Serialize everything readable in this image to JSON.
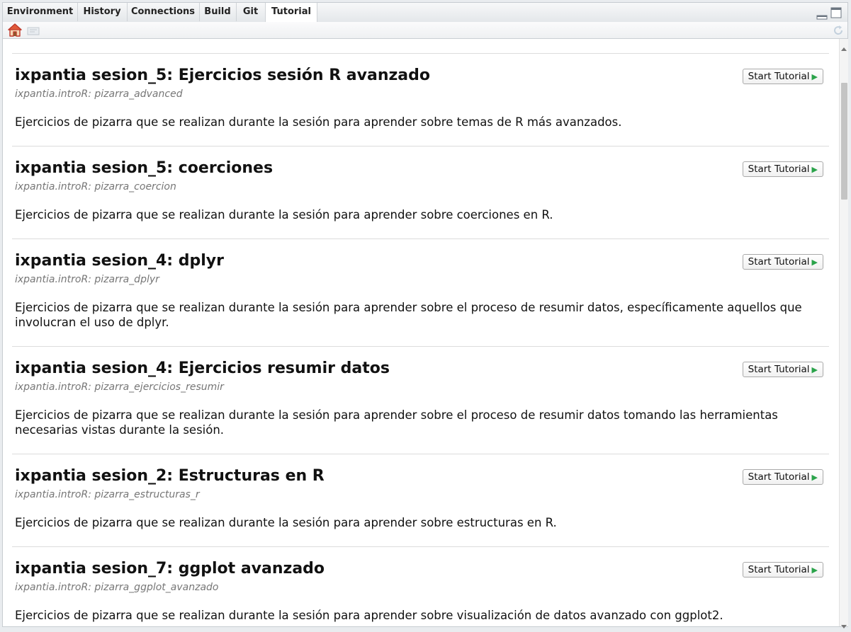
{
  "tabs": [
    {
      "label": "Environment",
      "active": false
    },
    {
      "label": "History",
      "active": false
    },
    {
      "label": "Connections",
      "active": false
    },
    {
      "label": "Build",
      "active": false
    },
    {
      "label": "Git",
      "active": false
    },
    {
      "label": "Tutorial",
      "active": true
    }
  ],
  "toolbar": {
    "home_icon": "home-icon",
    "stop_icon": "stop-icon",
    "refresh_icon": "refresh-icon"
  },
  "tutorials": [
    {
      "title": "ixpantia sesion_5: Ejercicios sesión R avanzado",
      "package": "ixpantia.introR: pizarra_advanced",
      "description": "Ejercicios de pizarra que se realizan durante la sesión para aprender sobre temas de R más avanzados.",
      "button": "Start Tutorial"
    },
    {
      "title": "ixpantia sesion_5: coerciones",
      "package": "ixpantia.introR: pizarra_coercion",
      "description": "Ejercicios de pizarra que se realizan durante la sesión para aprender sobre coerciones en R.",
      "button": "Start Tutorial"
    },
    {
      "title": "ixpantia sesion_4: dplyr",
      "package": "ixpantia.introR: pizarra_dplyr",
      "description": "Ejercicios de pizarra que se realizan durante la sesión para aprender sobre el proceso de resumir datos, específicamente aquellos que involucran el uso de dplyr.",
      "button": "Start Tutorial"
    },
    {
      "title": "ixpantia sesion_4: Ejercicios resumir datos",
      "package": "ixpantia.introR: pizarra_ejercicios_resumir",
      "description": "Ejercicios de pizarra que se realizan durante la sesión para aprender sobre el proceso de resumir datos tomando las herramientas necesarias vistas durante la sesión.",
      "button": "Start Tutorial"
    },
    {
      "title": "ixpantia sesion_2: Estructuras en R",
      "package": "ixpantia.introR: pizarra_estructuras_r",
      "description": "Ejercicios de pizarra que se realizan durante la sesión para aprender sobre estructuras en R.",
      "button": "Start Tutorial"
    },
    {
      "title": "ixpantia sesion_7: ggplot avanzado",
      "package": "ixpantia.introR: pizarra_ggplot_avanzado",
      "description": "Ejercicios de pizarra que se realizan durante la sesión para aprender sobre visualización de datos avanzado con ggplot2.",
      "button": "Start Tutorial"
    }
  ],
  "colors": {
    "play_icon": "#2aa34a",
    "package_text": "#767676"
  }
}
